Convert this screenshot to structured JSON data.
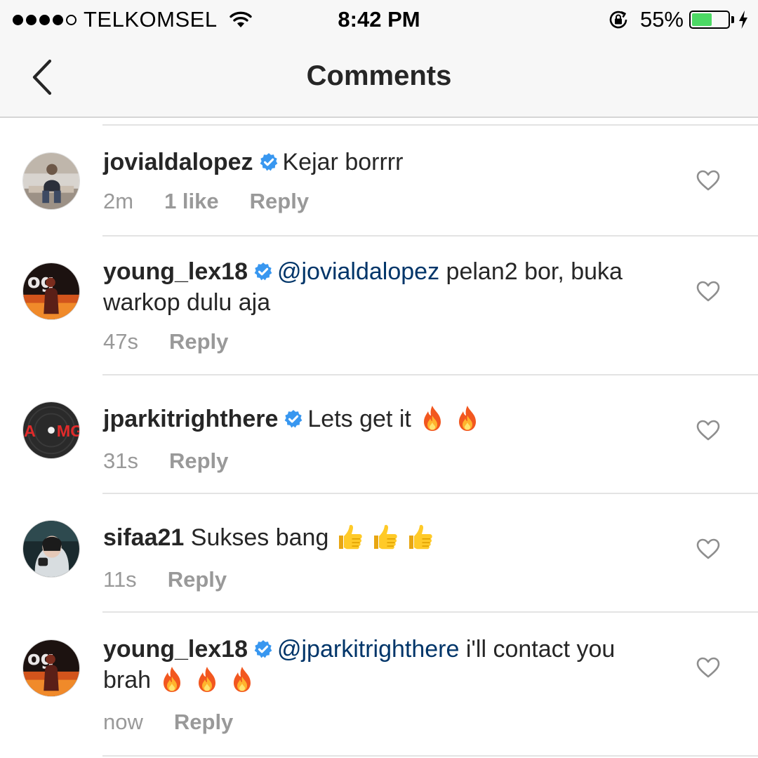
{
  "status_bar": {
    "carrier": "TELKOMSEL",
    "time": "8:42 PM",
    "battery": "55%",
    "battery_level": 0.55,
    "signal_bars": 4,
    "signal_max": 5
  },
  "nav": {
    "title": "Comments",
    "back_icon": "chevron-left-icon"
  },
  "colors": {
    "mention": "#003569",
    "verified": "#3897f0",
    "meta": "#999999",
    "battery": "#4cd964"
  },
  "comments": [
    {
      "username": "jovialdalopez",
      "verified": true,
      "mention": "",
      "text": "Kejar borrrr",
      "time": "2m",
      "likes": "1 like",
      "reply": "Reply",
      "emoji": []
    },
    {
      "username": "young_lex18",
      "verified": true,
      "mention": "@jovialdalopez",
      "text": "pelan2 bor, buka warkop dulu aja",
      "time": "47s",
      "likes": "",
      "reply": "Reply",
      "emoji": []
    },
    {
      "username": "jparkitrighthere",
      "verified": true,
      "mention": "",
      "text": "Lets get it",
      "time": "31s",
      "likes": "",
      "reply": "Reply",
      "emoji": [
        "fire-emoji",
        "fire-emoji"
      ]
    },
    {
      "username": "sifaa21",
      "verified": false,
      "mention": "",
      "text": "Sukses bang",
      "time": "11s",
      "likes": "",
      "reply": "Reply",
      "emoji": [
        "thumbs-up-emoji",
        "thumbs-up-emoji",
        "thumbs-up-emoji"
      ]
    },
    {
      "username": "young_lex18",
      "verified": true,
      "mention": "@jparkitrighthere",
      "text": "i'll contact you brah",
      "time": "now",
      "likes": "",
      "reply": "Reply",
      "emoji": [
        "fire-emoji",
        "fire-emoji",
        "fire-emoji"
      ]
    }
  ],
  "avatar_logo_text": "A MG"
}
